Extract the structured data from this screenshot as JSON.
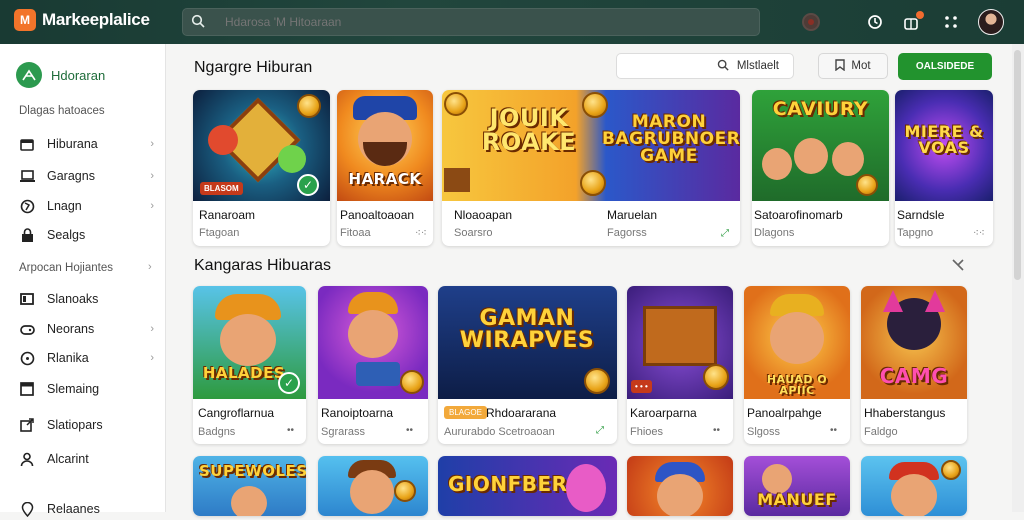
{
  "app": {
    "logo_letter": "M",
    "logo_text": "Markeeplalice"
  },
  "search": {
    "placeholder": "Hdarosa 'M Hitoaraan"
  },
  "header_icons": [
    "record-icon",
    "refresh-icon",
    "gift-icon",
    "grid-icon"
  ],
  "sidebar": {
    "title": "Hdoraran",
    "section1": "Dlagas hatoaces",
    "items1": [
      {
        "label": "Hiburana",
        "icon": "wallet-icon"
      },
      {
        "label": "Garagns",
        "icon": "laptop-icon"
      },
      {
        "label": "Lnagn",
        "icon": "globe-icon"
      },
      {
        "label": "Sealgs",
        "icon": "lock-icon"
      }
    ],
    "section2": "Arpocan Hojiantes",
    "items2": [
      {
        "label": "Slanoaks",
        "icon": "desktop-icon"
      },
      {
        "label": "Neorans",
        "icon": "controller-icon"
      },
      {
        "label": "Rlanika",
        "icon": "compass-icon"
      },
      {
        "label": "Slemaing",
        "icon": "box-icon"
      },
      {
        "label": "Slatiopars",
        "icon": "share-icon"
      },
      {
        "label": "Alcarint",
        "icon": "user-icon"
      },
      {
        "label": "Relaanes",
        "icon": "pin-icon"
      }
    ]
  },
  "main": {
    "title": "Ngargre Hiburan",
    "filter_search": "Mlstlaelt",
    "button2": "Mot",
    "button3": "OALSIDEDE",
    "section2_title": "Kangaras Hibuaras"
  },
  "row1": [
    {
      "name": "Ranaroam",
      "sub": "Ftagoan",
      "meta": "",
      "tag": "BLASOM"
    },
    {
      "name": "Panoaltoaoan",
      "sub": "Fitoaa",
      "meta": "⁖⁖",
      "caption": "HARACK"
    },
    {
      "name": "Nloaoapan",
      "sub": "Soarsro",
      "meta": "",
      "caption": "JOUIK ROAKE"
    },
    {
      "name": "Maruelan",
      "sub": "Fagorss",
      "meta": "⤢",
      "caption": "MARON BAGRUBNOER GAME"
    },
    {
      "name": "Satoarofinomarb",
      "sub": "Dlagons",
      "meta": "",
      "caption": "CAVIURY"
    },
    {
      "name": "Sarndsle",
      "sub": "Tapgno",
      "meta": "⁖⁖",
      "caption": "MIERE & VOAS"
    }
  ],
  "row2": [
    {
      "name": "Cangroflarnua",
      "sub": "Badgns",
      "meta": "••",
      "caption": "HALADES"
    },
    {
      "name": "Ranoiptoarna",
      "sub": "Sgrarass",
      "meta": "••",
      "caption": ""
    },
    {
      "name": "Rhdoararana",
      "sub": "Aururabdo Scetroaoan",
      "meta": "⤢",
      "badge": "BLAGOE",
      "caption": "GAMAN WIRAPVES"
    },
    {
      "name": "Karoarparna",
      "sub": "Fhioes",
      "meta": "••",
      "caption": ""
    },
    {
      "name": "Panoalrpahge",
      "sub": "Slgoss",
      "meta": "••",
      "caption": "HAUAD O APIIC"
    },
    {
      "name": "Hhaberstangus",
      "sub": "Faldgo",
      "meta": "",
      "caption": "CAMG"
    }
  ],
  "row3": [
    {
      "caption": "SUPEWOLES"
    },
    {
      "caption": ""
    },
    {
      "caption": "GIONFBER"
    },
    {
      "caption": ""
    },
    {
      "caption": "MANUEF"
    },
    {
      "caption": ""
    }
  ]
}
